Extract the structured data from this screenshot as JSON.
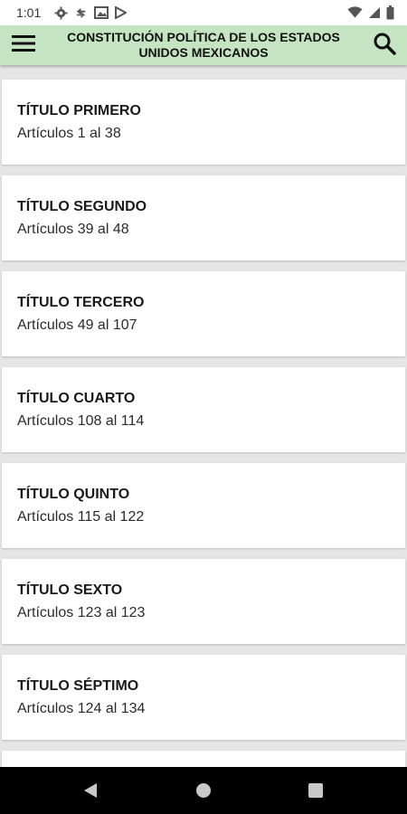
{
  "status_bar": {
    "time": "1:01",
    "left_icons": [
      "gear-icon",
      "sync-icon",
      "image-icon",
      "play-store-icon"
    ],
    "right_icons": [
      "wifi-icon",
      "signal-icon",
      "battery-icon"
    ]
  },
  "app_bar": {
    "title_line1": "CONSTITUCIÓN POLÍTICA DE LOS ESTADOS",
    "title_line2": "UNIDOS MEXICANOS",
    "menu_icon": "hamburger-menu-icon",
    "search_icon": "search-icon",
    "background_color": "#c5e4c2"
  },
  "titles": [
    {
      "title": "TÍTULO PRIMERO",
      "articles": "Artículos 1 al 38"
    },
    {
      "title": "TÍTULO SEGUNDO",
      "articles": "Artículos 39 al 48"
    },
    {
      "title": "TÍTULO TERCERO",
      "articles": "Artículos 49 al 107"
    },
    {
      "title": "TÍTULO CUARTO",
      "articles": "Artículos 108 al 114"
    },
    {
      "title": "TÍTULO QUINTO",
      "articles": "Artículos 115 al 122"
    },
    {
      "title": "TÍTULO SEXTO",
      "articles": "Artículos 123 al 123"
    },
    {
      "title": "TÍTULO SÉPTIMO",
      "articles": "Artículos 124 al 134"
    }
  ],
  "nav_bar": {
    "back_icon": "back-triangle-icon",
    "home_icon": "home-circle-icon",
    "recents_icon": "recents-square-icon"
  }
}
